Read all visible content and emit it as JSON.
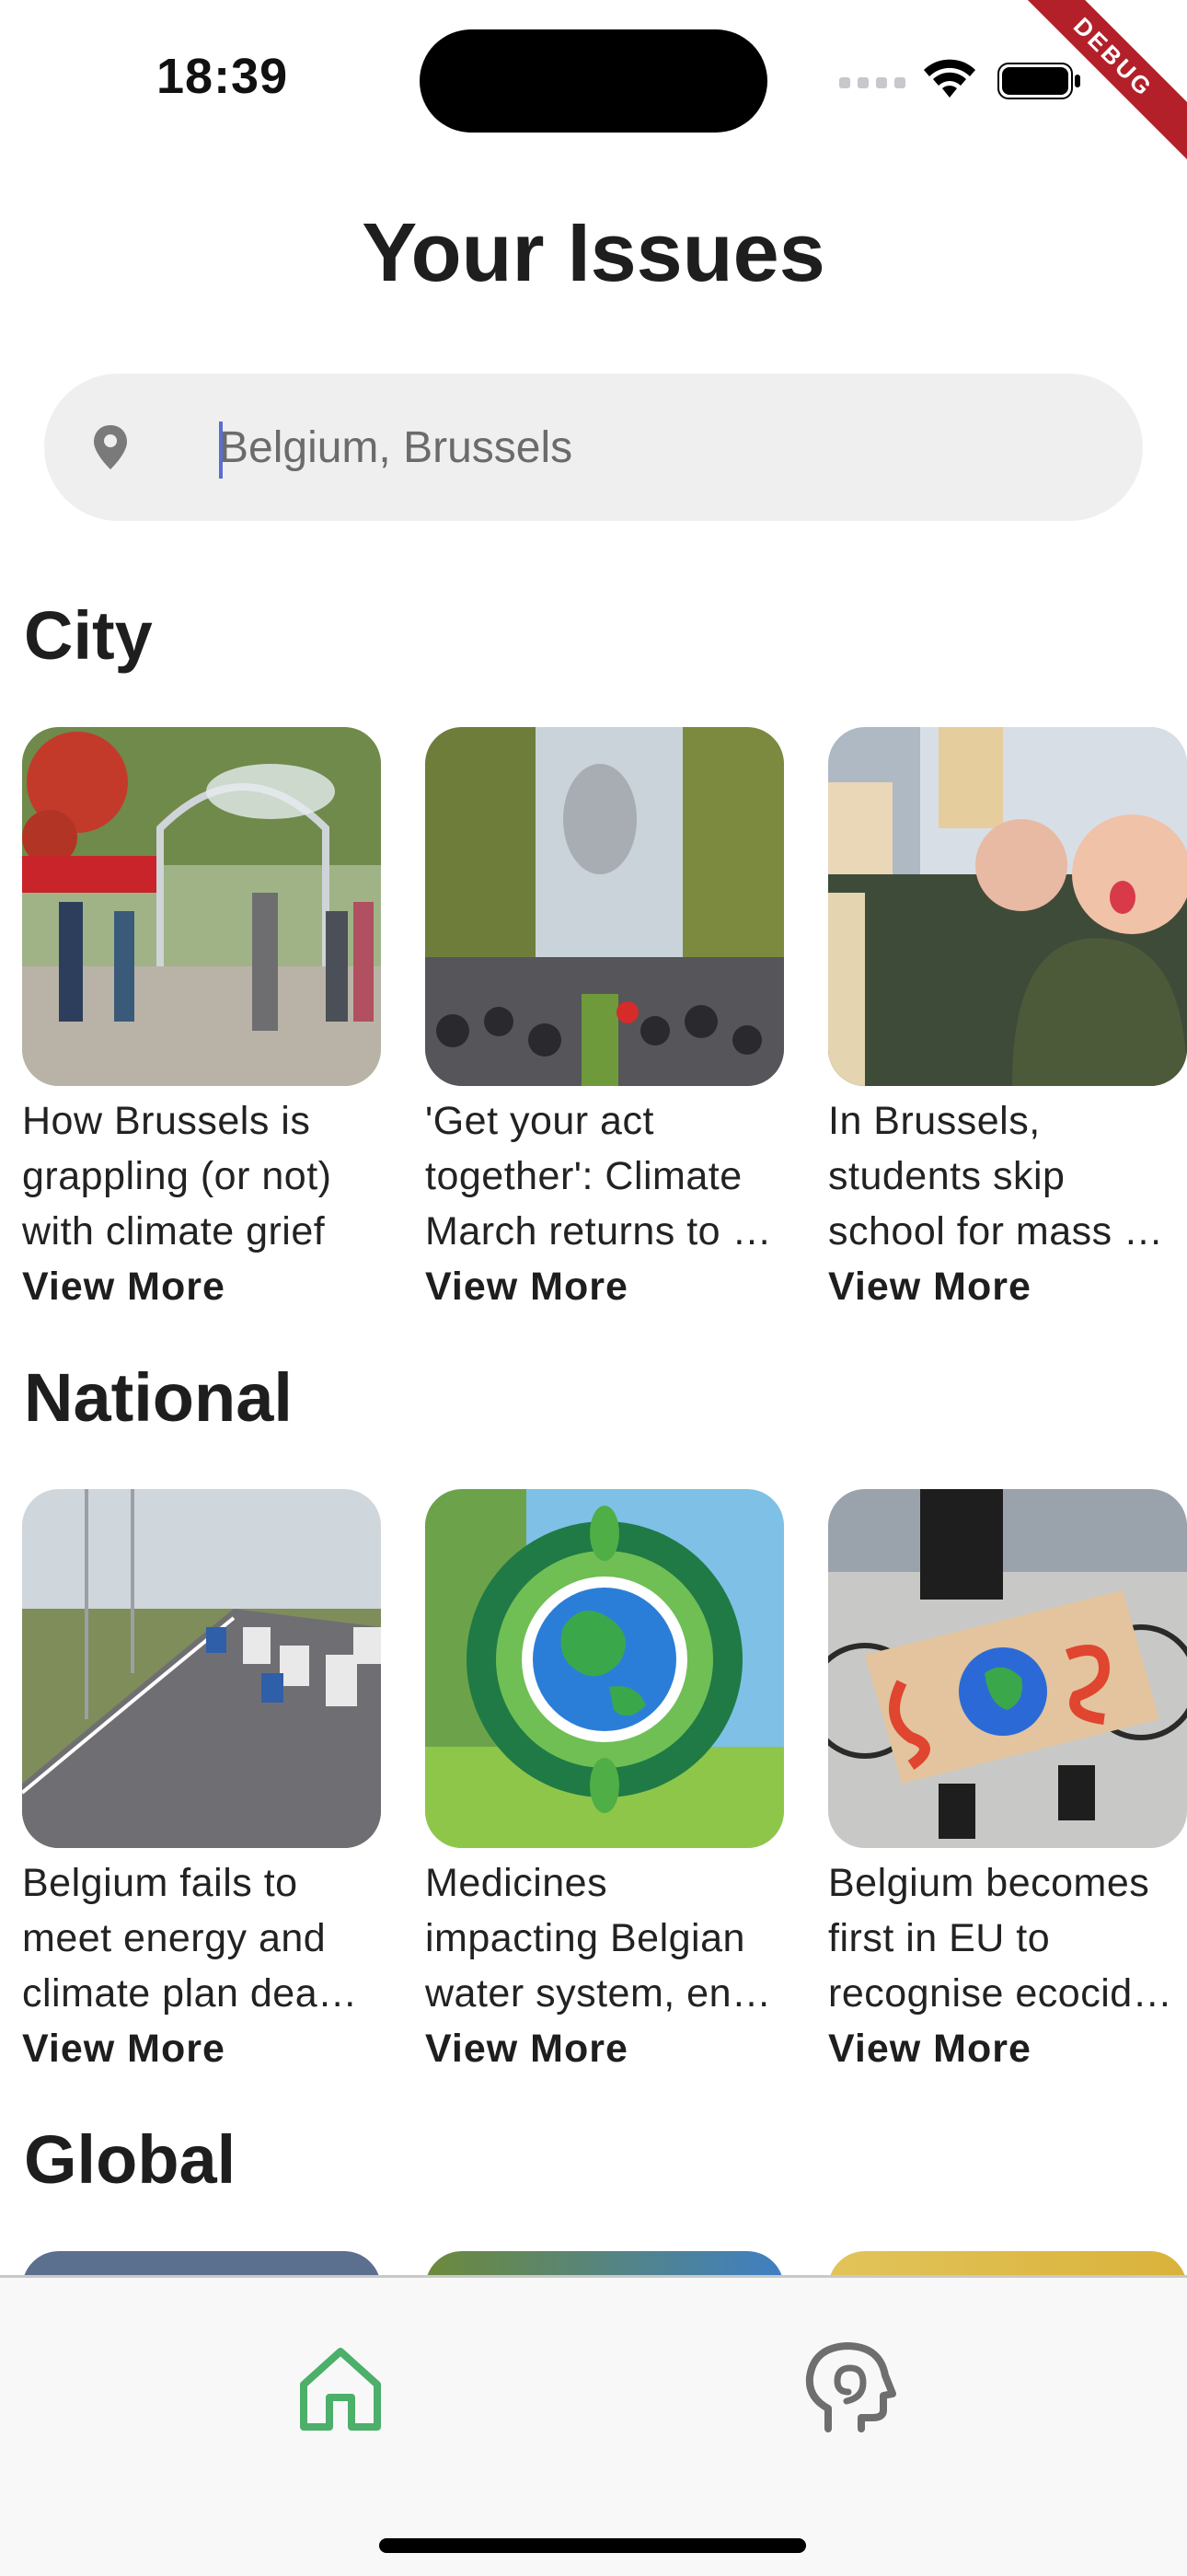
{
  "status_bar": {
    "time": "18:39",
    "debug_label": "DEBUG"
  },
  "header": {
    "title": "Your Issues"
  },
  "search": {
    "value": "Belgium, Brussels",
    "placeholder": "Belgium, Brussels",
    "icon": "location-pin-icon"
  },
  "sections": [
    {
      "title": "City",
      "cards": [
        {
          "text": "How Brussels is grappling (or not) with climate grief",
          "more": "View More"
        },
        {
          "text": "'Get your act together': Climate March returns to …",
          "more": "View More"
        },
        {
          "text": "In Brussels, students skip school for mass …",
          "more": "View More"
        }
      ]
    },
    {
      "title": "National",
      "cards": [
        {
          "text": "Belgium fails to meet energy and climate plan dea…",
          "more": "View More"
        },
        {
          "text": "Medicines impacting Belgian water system, en…",
          "more": "View More"
        },
        {
          "text": "Belgium becomes first in EU to recognise ecocid…",
          "more": "View More"
        }
      ]
    },
    {
      "title": "Global"
    }
  ],
  "bottom_nav": {
    "items": [
      {
        "icon": "home-icon",
        "active": true
      },
      {
        "icon": "ai-head-icon",
        "active": false
      }
    ]
  },
  "colors": {
    "accent": "#4caf6a",
    "inactive": "#6e6e6e"
  }
}
